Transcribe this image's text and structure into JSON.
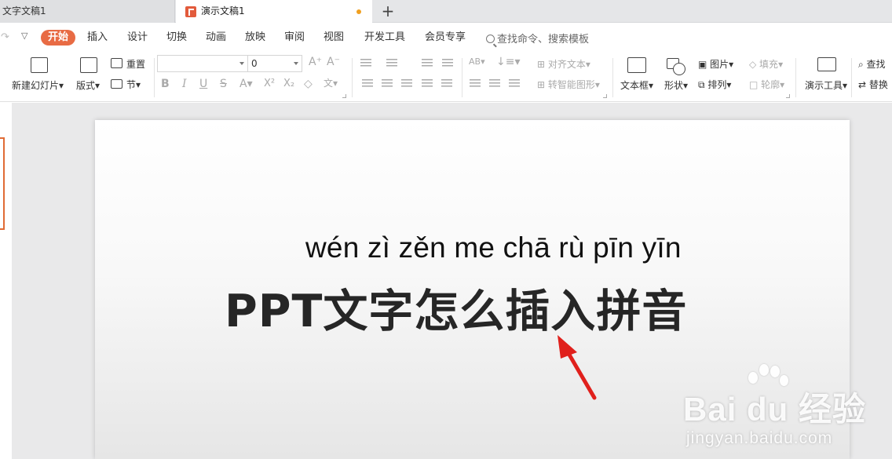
{
  "tabs": [
    {
      "label": "文字文稿1"
    },
    {
      "label": "演示文稿1"
    }
  ],
  "menu": {
    "items": [
      "开始",
      "插入",
      "设计",
      "切换",
      "动画",
      "放映",
      "审阅",
      "视图",
      "开发工具",
      "会员专享"
    ],
    "search_placeholder": "查找命令、搜索模板"
  },
  "ribbon": {
    "new_slide": "新建幻灯片",
    "layout": "版式",
    "reset": "重置",
    "section": "节",
    "font_name": "",
    "font_size": "0",
    "align_text": "对齐文本",
    "convert_smartart": "转智能图形",
    "textbox": "文本框",
    "shape": "形状",
    "picture": "图片",
    "fill": "填充",
    "arrange": "排列",
    "outline": "轮廓",
    "present_tools": "演示工具",
    "find": "查找",
    "replace": "替换"
  },
  "slide": {
    "pinyin": "wén zì zěn me chā rù pīn yīn",
    "title": "PPT文字怎么插入拼音"
  },
  "watermark": {
    "logo": "Bai  du 经验",
    "url": "jingyan.baidu.com"
  },
  "colors": {
    "accent": "#e86b44",
    "arrow": "#e0201c"
  }
}
